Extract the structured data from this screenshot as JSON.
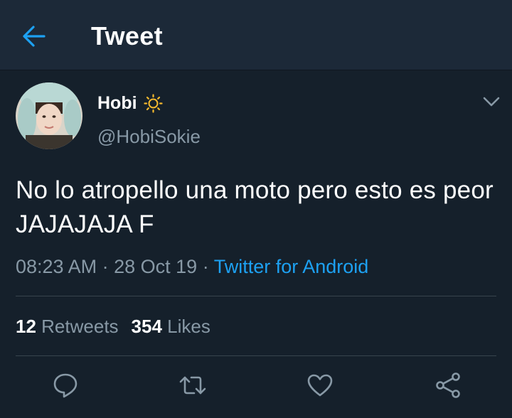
{
  "header": {
    "title": "Tweet",
    "back_icon": "arrow-left-icon"
  },
  "author": {
    "name": "Hobi",
    "name_emoji_icon": "sun-icon",
    "handle": "@HobiSokie"
  },
  "tweet": {
    "text": "No lo atropello una moto pero esto es peor JAJAJAJA F",
    "time": "08:23 AM",
    "separator": "·",
    "date": "28 Oct 19",
    "source": "Twitter for Android"
  },
  "stats": {
    "retweets_count": "12",
    "retweets_label": "Retweets",
    "likes_count": "354",
    "likes_label": "Likes"
  },
  "actions": [
    "reply-icon",
    "retweet-icon",
    "like-icon",
    "share-icon"
  ],
  "colors": {
    "background": "#15202b",
    "header": "#1c2938",
    "accent": "#1da1f2",
    "secondary": "#8899a6",
    "divider": "#38444d"
  }
}
